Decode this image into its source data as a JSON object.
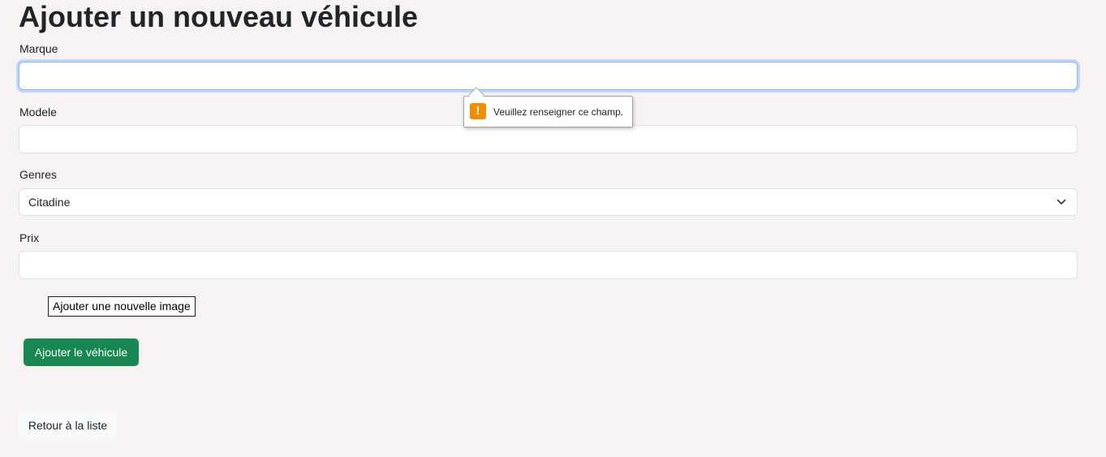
{
  "page": {
    "title": "Ajouter un nouveau véhicule"
  },
  "form": {
    "marque": {
      "label": "Marque",
      "value": ""
    },
    "modele": {
      "label": "Modele",
      "value": ""
    },
    "genres": {
      "label": "Genres",
      "selected": "Citadine"
    },
    "prix": {
      "label": "Prix",
      "value": ""
    },
    "image_button_label": "Ajouter une nouvelle image",
    "submit_label": "Ajouter le véhicule"
  },
  "validation_tooltip": {
    "icon": "warning-icon",
    "icon_glyph": "!",
    "message": "Veuillez renseigner ce champ."
  },
  "back_link_label": "Retour à la liste",
  "colors": {
    "background": "#f7f3f3",
    "submit": "#198754",
    "focus_border": "#86b7fe",
    "warning": "#f28c00"
  }
}
